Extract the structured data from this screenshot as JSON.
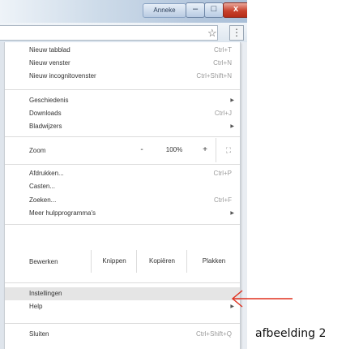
{
  "window": {
    "user_badge": "Anneke",
    "minimize_glyph": "–",
    "maximize_glyph": "□",
    "close_glyph": "x"
  },
  "toolbar": {
    "bookmark_icon": "☆",
    "menu_icon": "⋮"
  },
  "menu": {
    "group1": [
      {
        "label": "Nieuw tabblad",
        "shortcut": "Ctrl+T"
      },
      {
        "label": "Nieuw venster",
        "shortcut": "Ctrl+N"
      },
      {
        "label": "Nieuw incognitovenster",
        "shortcut": "Ctrl+Shift+N"
      }
    ],
    "group2": [
      {
        "label": "Geschiedenis",
        "shortcut": "",
        "submenu": true
      },
      {
        "label": "Downloads",
        "shortcut": "Ctrl+J"
      },
      {
        "label": "Bladwijzers",
        "shortcut": "",
        "submenu": true
      }
    ],
    "zoom": {
      "label": "Zoom",
      "minus": "-",
      "value": "100%",
      "plus": "+",
      "fullscreen": "⛶"
    },
    "group3": [
      {
        "label": "Afdrukken...",
        "shortcut": "Ctrl+P"
      },
      {
        "label": "Casten...",
        "shortcut": ""
      },
      {
        "label": "Zoeken...",
        "shortcut": "Ctrl+F"
      },
      {
        "label": "Meer hulpprogramma's",
        "shortcut": "",
        "submenu": true
      }
    ],
    "edit": {
      "label": "Bewerken",
      "cut": "Knippen",
      "copy": "Kopiëren",
      "paste": "Plakken"
    },
    "group4": [
      {
        "label": "Instellingen",
        "shortcut": "",
        "highlighted": true
      },
      {
        "label": "Help",
        "shortcut": "",
        "submenu": true
      }
    ],
    "group5": [
      {
        "label": "Sluiten",
        "shortcut": "Ctrl+Shift+Q"
      }
    ]
  },
  "annotation": {
    "caption": "afbeelding 2",
    "arrow_color": "#e0301e"
  }
}
